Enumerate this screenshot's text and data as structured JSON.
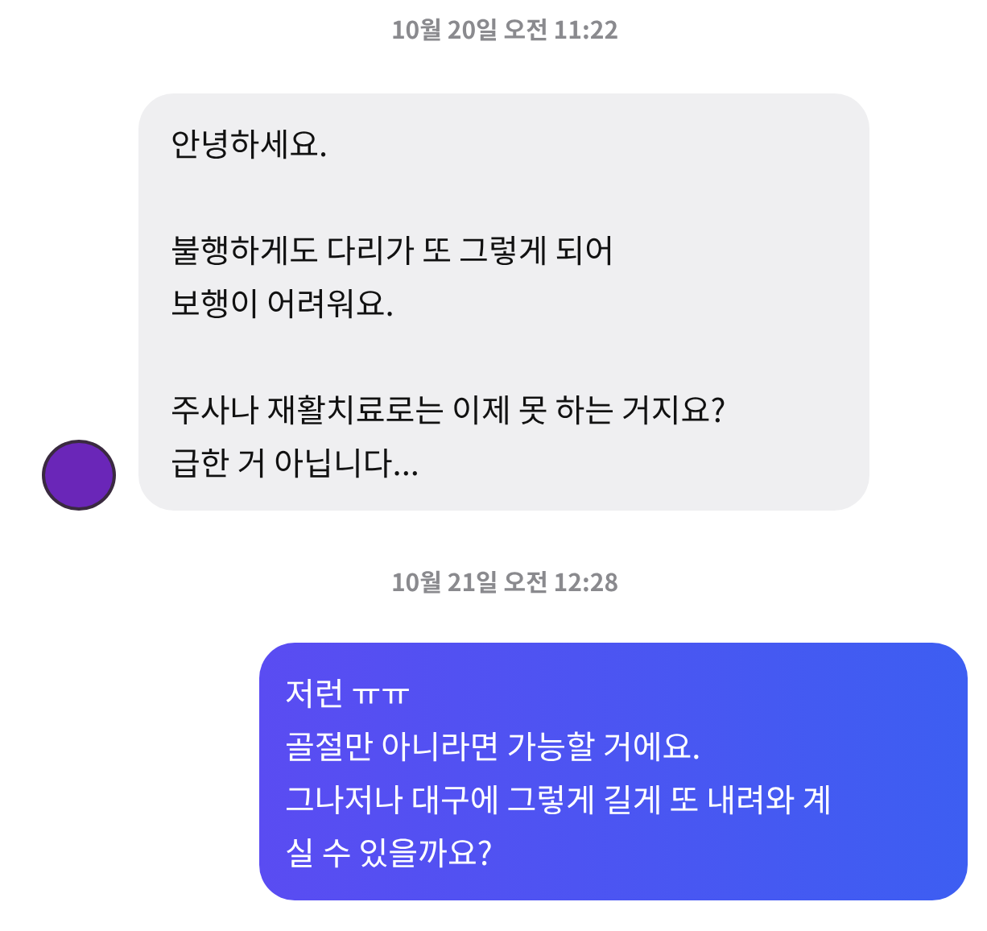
{
  "messages": [
    {
      "kind": "timestamp",
      "text": "10월 20일 오전 11:22"
    },
    {
      "kind": "incoming",
      "text": "안녕하세요.\n\n불행하게도 다리가 또 그렇게 되어\n보행이 어려워요.\n\n주사나 재활치료로는 이제 못 하는 거지요?\n급한 거 아닙니다..."
    },
    {
      "kind": "timestamp",
      "text": "10월 21일 오전 12:28"
    },
    {
      "kind": "outgoing",
      "text": "저런 ㅠㅠ\n골절만 아니라면 가능할 거에요.\n그나저나 대구에 그렇게 길게 또 내려와 계\n실 수 있을까요?"
    }
  ]
}
